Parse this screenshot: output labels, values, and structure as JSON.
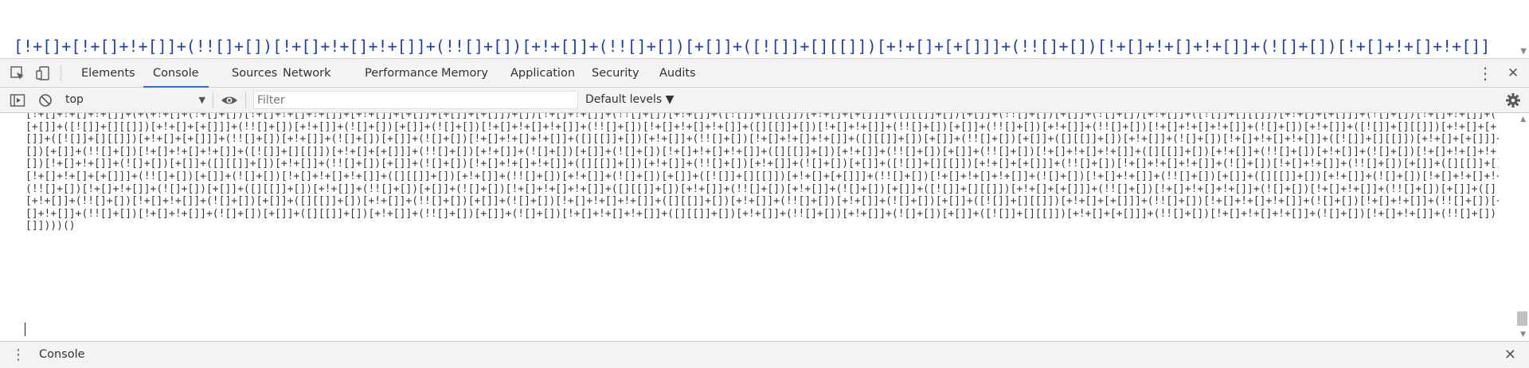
{
  "page_view": {
    "lines": [
      "[!+[]+[!+[]+!+[]]+(!![]+[])[!+[]+!+[]+!+[]]+(!![]+[])[+!+[]]+(!![]+[])[+[]]+([![]]+[][[]])[+!+[]+[+[]]]+(!![]+[])[!+[]+!+[]+!+[]]+(![]+[])[!+[]+!+[]+!+[]]",
      "[!+[]+!+[]+!+[]]+(!![]+[])[+!+[]])[+!+[]]][+!+[]+[!+[]+!+[]]+(!![]+[])[+[]]+(![]+[])[!+[]+!+[]]+([![]]+[][[]])[+!+[]+[+[]]]+(!![]+[])[+[]]+([][[]]+[])[+[]]+([![]]+[][[]])",
      "[+!+[]+[+!+[]]]+(![]+[])[!+[]+!+[]]+(!![]+[])[+!+[]]+(![]+[])[+!+[]]+(!![]+[])[+[]]+(!![]+[])[!+[]+!+[]+!+[]]+([![]]+[][[]])[+!+[]+[+[]]]+(!![]+[])[!+[]+!+[]+!+[]]",
      "[!+[]+!+[]+!+[]]+(!![]+[])[!+[]+!+[]]+(![]+[])[+!+[]]+(![]+[])[!+[]+!+[]]+(!![]+[])[!+[]+!+[]+!+[]]+([![]]+[][[]])[+!+[]+[+[]]]+(!![]+[])[!+[]+!+[]+!+[]]"
    ],
    "scroll_arrow": "▼"
  },
  "devtools": {
    "toolbar_icons": {
      "inspect": "inspect-element-icon",
      "device": "device-toolbar-icon"
    },
    "tabs": [
      {
        "label": "Elements",
        "active": false
      },
      {
        "label": "Console",
        "active": true
      },
      {
        "label": "Sources",
        "active": false
      },
      {
        "label": "Network",
        "active": false
      },
      {
        "label": "Performance",
        "active": false
      },
      {
        "label": "Memory",
        "active": false
      },
      {
        "label": "Application",
        "active": false
      },
      {
        "label": "Security",
        "active": false
      },
      {
        "label": "Audits",
        "active": false
      }
    ],
    "menu_glyph": "⋮",
    "close_glyph": "✕"
  },
  "console_toolbar": {
    "context": "top",
    "context_caret": "▼",
    "filter_placeholder": "Filter",
    "levels": "Default levels ▼"
  },
  "console": {
    "lines": [
      "[!+[]+!+[]+!+[]]+(+(+!+[]+(!+[]+[])[!+[]+!+[]+!+[]]+[+!+[]]+[+[]]+[+[]]+[+[]])+[])[!+[]+!+[]]+(!![]+[])[+!+[]]+([![]]+[][[]])[+!+[]+[+[]]]+([][[]]+[])[+[]]+(!![]+[])[+[]]+(![]+[])[+!+[]]+([![]]+[][[]])[+!+[]+[+[]]]+(![]+[])[!+[]+!+[]]+(!![]+[])[!+[]+!+[]+!+[]]+([][[]]+[])[+[]]",
      "[+[]]+([![]]+[][[]])[+!+[]+[+[]]]+(!![]+[])[+!+[]]+(![]+[])[+[]]+(![]+[])[!+[]+!+[]+!+[]]+(!![]+[])[!+[]+!+[]+!+[]]+([][[]]+[])[!+[]+!+[]]+(!![]+[])[+[]]+(!![]+[])[+!+[]]+(!![]+[])[!+[]+!+[]+!+[]]+(![]+[])[+!+[]]+([![]]+[][[]])[+!+[]+[+[]]]+(![]+[])[!+[]+!+[]]+(!![]+[])[+[]]+(!",
      "[]]+([![]]+[][[]])[+!+[]+[+[]]]+(!![]+[])[+!+[]]+(![]+[])[+[]]+(![]+[])[!+[]+!+[]+!+[]]+([][[]]+[])[+!+[]]+(!![]+[])[!+[]+!+[]+!+[]]+([][[]]+[])[+[]]+(!![]+[])[+[]]+([][[]]+[])[+!+[]]+(![]+[])[!+[]+!+[]+!+[]]+([![]]+[][[]])[+!+[]+[+[]]]+(!![]+[])[+!+[]]+(![]+[])[!+[]+!+[]]+(!![]+",
      "[])[+[]]+(!![]+[])[!+[]+!+[]+!+[]]+([![]]+[][[]])[+!+[]+[+[]]]+(!![]+[])[+!+[]]+(![]+[])[+[]]+(![]+[])[!+[]+!+[]+!+[]]+([][[]]+[])[+!+[]]+(!![]+[])[+[]]+(!![]+[])[!+[]+!+[]+!+[]]+([][[]]+[])[+!+[]]+(!![]+[])[+!+[]]+(![]+[])[!+[]+!+[]+!+[]]+([![]]+[][[]])[+!+[]+[+[]]]+(!![]+",
      "[])[!+[]+!+[]]+(![]+[])[+[]]+([][[]]+[])[+!+[]]+(!![]+[])[+[]]+(![]+[])[!+[]+!+[]+!+[]]+([][[]]+[])[+!+[]]+(!![]+[])[+!+[]]+(![]+[])[+[]]+([![]]+[][[]])[+!+[]+[+[]]]+(!![]+[])[!+[]+!+[]+!+[]]+(![]+[])[!+[]+!+[]]+(!![]+[])[+[]]+([][[]]+[])[+!+[]]+(![]+[])[!+[]+!+[]+!+[]]+(!+",
      "[!+[]+!+[]+[+[]]]+(!![]+[])[+[]]+(![]+[])[!+[]+!+[]+!+[]]+([][[]]+[])[+!+[]]+(!![]+[])[+!+[]]+(![]+[])[+[]]+([![]]+[][[]])[+!+[]+[+[]]]+(!![]+[])[!+[]+!+[]+!+[]]+(![]+[])[!+[]+!+[]]+(!![]+[])[+[]]+([][[]]+[])[+!+[]]+(![]+[])[!+[]+!+[]+!+[]]+(!![]+[])[+!+[]]+(![]+[])[+[]]+(!![]+",
      "(!![]+[])[!+[]+!+[]]+(![]+[])[+[]]+([][[]]+[])[+!+[]]+(!![]+[])[+[]]+(![]+[])[!+[]+!+[]+!+[]]+([][[]]+[])[+!+[]]+(!![]+[])[+!+[]]+(![]+[])[+[]]+([![]]+[][[]])[+!+[]+[+[]]]+(!![]+[])[!+[]+!+[]+!+[]]+(![]+[])[!+[]+!+[]]+(!![]+[])[+[]]+([][[]]+[])[+!+[]]+(![]+[])[!+[]+!+[]",
      "[+!+[]]+(!![]+[])[!+[]+!+[]]+(![]+[])[+[]]+([][[]]+[])[+!+[]]+(!![]+[])[+[]]+(![]+[])[!+[]+!+[]+!+[]]+([][[]]+[])[+!+[]]+(!![]+[])[+!+[]]+(![]+[])[+[]]+([![]]+[][[]])[+!+[]+[+[]]]+(!![]+[])[!+[]+!+[]+!+[]]+(![]+[])[!+[]+!+[]]+(!![]+[])[+[]]+([][[]]+[])[+!+[]]+(![]+[])[!+[]+!+",
      "[]+!+[]]+(!![]+[])[!+[]+!+[]]+(![]+[])[+[]]+([][[]]+[])[+!+[]]+(!![]+[])[+[]]+(![]+[])[!+[]+!+[]+!+[]]+([][[]]+[])[+!+[]]+(!![]+[])[+!+[]]+(![]+[])[+[]]+([![]]+[][[]])[+!+[]+[+[]]]+(!![]+[])[!+[]+!+[]+!+[]]+(![]+[])[!+[]+!+[]]+(!![]+[])[+[]]+([][[]]+[])[+!+[]]+(![]+[])[!+[]+!+[",
      "[]])))()"
    ]
  },
  "drawer": {
    "menu_glyph": "⋮",
    "tab_label": "Console",
    "close_glyph": "✕"
  }
}
